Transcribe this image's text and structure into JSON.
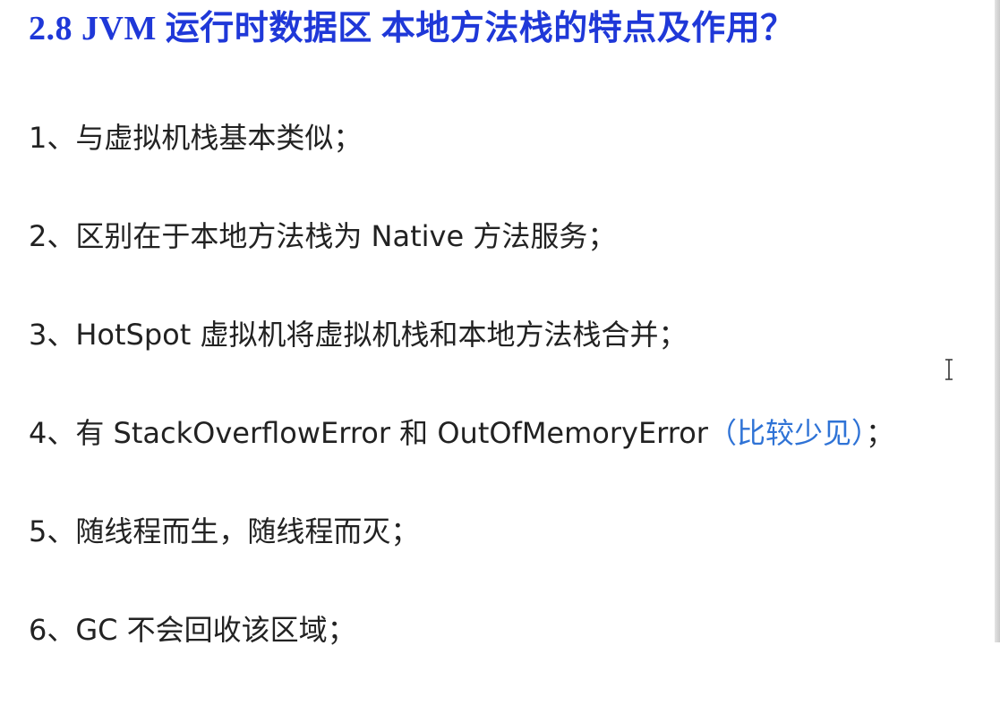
{
  "title": "2.8  JVM 运行时数据区  本地方法栈的特点及作用？",
  "items": [
    {
      "text": "1、与虚拟机栈基本类似；"
    },
    {
      "text": "2、区别在于本地方法栈为 Native 方法服务；"
    },
    {
      "text": "3、HotSpot 虚拟机将虚拟机栈和本地方法栈合并；"
    },
    {
      "text": "4、有 StackOverflowError 和 OutOfMemoryError",
      "note": "（比较少见）",
      "tail": "；"
    },
    {
      "text": "5、随线程而生，随线程而灭；"
    },
    {
      "text": "6、GC 不会回收该区域；"
    }
  ],
  "colors": {
    "title": "#1f38d8",
    "body_text": "#222222",
    "note": "#2f73d6"
  },
  "cursor": "text-cursor-icon"
}
